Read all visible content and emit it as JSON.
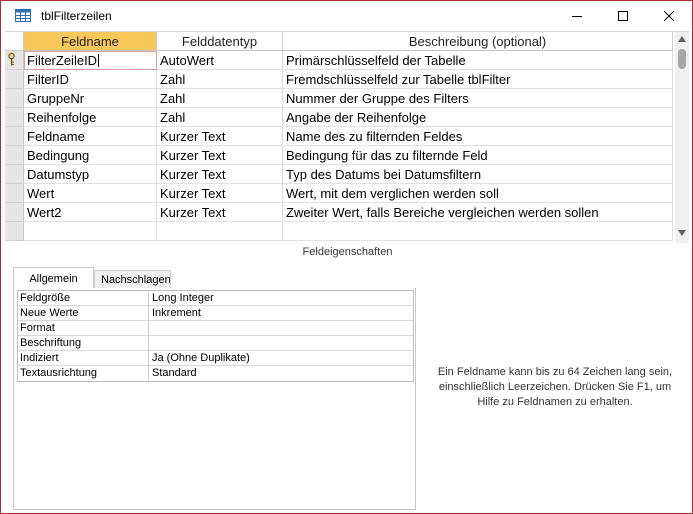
{
  "window": {
    "title": "tblFilterzeilen",
    "border_color": "#b0303a"
  },
  "grid": {
    "columns": [
      "Feldname",
      "Felddatentyp",
      "Beschreibung (optional)"
    ],
    "rows": [
      {
        "name": "FilterZeileID",
        "type": "AutoWert",
        "desc": "Primärschlüsselfeld der Tabelle",
        "key": true
      },
      {
        "name": "FilterID",
        "type": "Zahl",
        "desc": "Fremdschlüsselfeld zur Tabelle tblFilter"
      },
      {
        "name": "GruppeNr",
        "type": "Zahl",
        "desc": "Nummer der Gruppe des Filters"
      },
      {
        "name": "Reihenfolge",
        "type": "Zahl",
        "desc": "Angabe der Reihenfolge"
      },
      {
        "name": "Feldname",
        "type": "Kurzer Text",
        "desc": "Name des zu filternden Feldes"
      },
      {
        "name": "Bedingung",
        "type": "Kurzer Text",
        "desc": "Bedingung für das zu filternde Feld"
      },
      {
        "name": "Datumstyp",
        "type": "Kurzer Text",
        "desc": "Typ des Datums bei Datumsfiltern"
      },
      {
        "name": "Wert",
        "type": "Kurzer Text",
        "desc": "Wert, mit dem verglichen werden soll"
      },
      {
        "name": "Wert2",
        "type": "Kurzer Text",
        "desc": "Zweiter Wert, falls Bereiche vergleichen werden sollen"
      },
      {
        "name": "",
        "type": "",
        "desc": ""
      }
    ],
    "active_header_color": "#f8c95a"
  },
  "properties": {
    "title": "Feldeigenschaften",
    "tabs": [
      "Allgemein",
      "Nachschlagen"
    ],
    "rows": [
      {
        "label": "Feldgröße",
        "value": "Long Integer"
      },
      {
        "label": "Neue Werte",
        "value": "Inkrement"
      },
      {
        "label": "Format",
        "value": ""
      },
      {
        "label": "Beschriftung",
        "value": ""
      },
      {
        "label": "Indiziert",
        "value": "Ja (Ohne Duplikate)"
      },
      {
        "label": "Textausrichtung",
        "value": "Standard"
      }
    ],
    "help_text": "Ein Feldname kann bis zu 64 Zeichen lang sein, einschließlich Leerzeichen. Drücken Sie F1, um Hilfe zu Feldnamen zu erhalten."
  }
}
